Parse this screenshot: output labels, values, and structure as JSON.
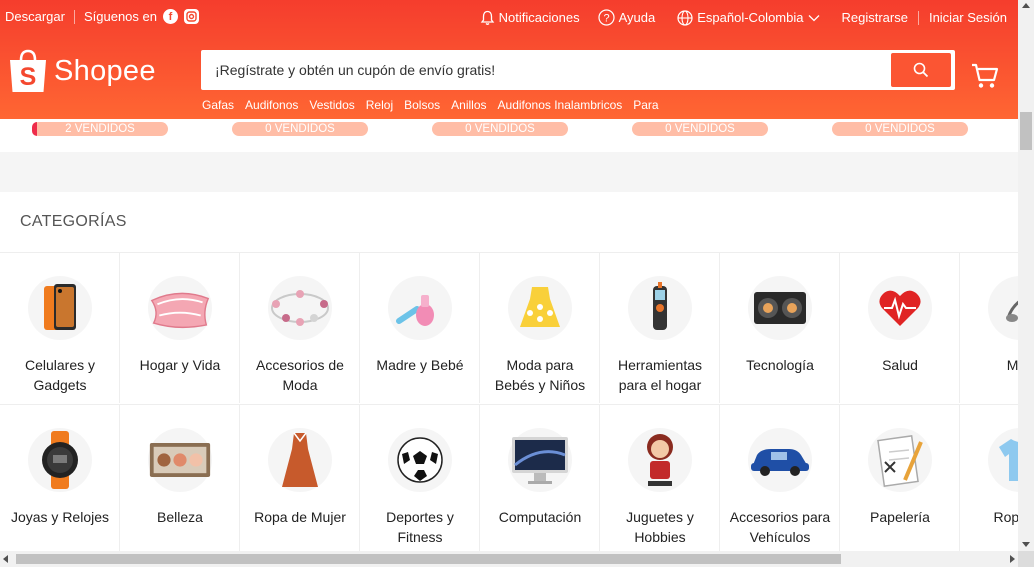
{
  "colors": {
    "brand": "#ee4d2d",
    "sold_fill": "#ee2c4a",
    "sold_bg": "#ffbda6"
  },
  "topbar": {
    "download": "Descargar",
    "follow_us": "Síguenos en",
    "notifications": "Notificaciones",
    "help": "Ayuda",
    "language": "Español-Colombia",
    "register": "Registrarse",
    "login": "Iniciar Sesión"
  },
  "logo": {
    "text": "Shopee"
  },
  "search": {
    "placeholder": "¡Regístrate y obtén un cupón de envío gratis!",
    "suggestions": [
      "Gafas",
      "Audifonos",
      "Vestidos",
      "Reloj",
      "Bolsos",
      "Anillos",
      "Audifonos Inalambricos",
      "Para"
    ]
  },
  "sold_badges": [
    {
      "label": "2 VENDIDOS",
      "progress": 0.04
    },
    {
      "label": "0 VENDIDOS",
      "progress": 0
    },
    {
      "label": "0 VENDIDOS",
      "progress": 0
    },
    {
      "label": "0 VENDIDOS",
      "progress": 0
    },
    {
      "label": "0 VENDIDOS",
      "progress": 0
    }
  ],
  "categories": {
    "title": "CATEGORÍAS",
    "rows": [
      [
        {
          "label": "Celulares y\nGadgets",
          "icon": "phone-icon"
        },
        {
          "label": "Hogar y Vida",
          "icon": "pillow-icon"
        },
        {
          "label": "Accesorios de\nModa",
          "icon": "bracelet-icon"
        },
        {
          "label": "Madre y Bebé",
          "icon": "nasal-aspirator-icon"
        },
        {
          "label": "Moda para\nBebés y Niños",
          "icon": "baby-dress-icon"
        },
        {
          "label": "Herramientas\npara el hogar",
          "icon": "multimeter-icon"
        },
        {
          "label": "Tecnología",
          "icon": "speaker-icon"
        },
        {
          "label": "Salud",
          "icon": "heart-icon"
        },
        {
          "label": "Mas",
          "icon": "pet-icon"
        }
      ],
      [
        {
          "label": "Joyas y Relojes",
          "icon": "watch-icon"
        },
        {
          "label": "Belleza",
          "icon": "eyeshadow-palette-icon"
        },
        {
          "label": "Ropa de Mujer",
          "icon": "dress-icon"
        },
        {
          "label": "Deportes y\nFitness",
          "icon": "soccer-ball-icon"
        },
        {
          "label": "Computación",
          "icon": "monitor-icon"
        },
        {
          "label": "Juguetes y\nHobbies",
          "icon": "figurine-icon"
        },
        {
          "label": "Accesorios para\nVehículos",
          "icon": "car-icon"
        },
        {
          "label": "Papelería",
          "icon": "notepad-icon"
        },
        {
          "label": "Ropa de",
          "icon": "tshirt-icon"
        }
      ]
    ]
  }
}
